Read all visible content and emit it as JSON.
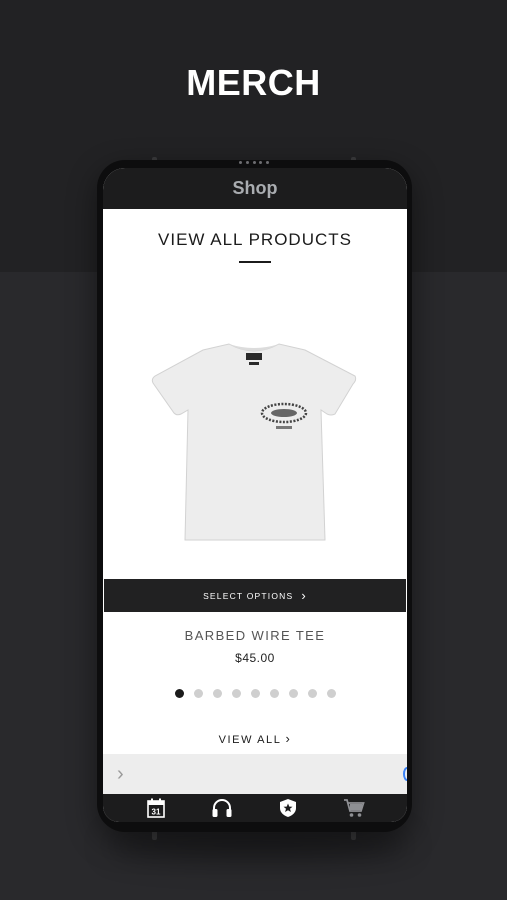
{
  "headline": "MERCH",
  "app": {
    "title": "Shop"
  },
  "section": {
    "title": "VIEW ALL PRODUCTS"
  },
  "product": {
    "image_icon": "tshirt-image",
    "select_label": "SELECT OPTIONS",
    "name": "BARBED WIRE TEE",
    "price": "$45.00"
  },
  "carousel": {
    "total": 9,
    "active_index": 0
  },
  "view_all_label": "VIEW ALL",
  "tabs": [
    {
      "name": "calendar",
      "icon": "calendar-icon",
      "label": "31"
    },
    {
      "name": "music",
      "icon": "headphones-icon"
    },
    {
      "name": "badge",
      "icon": "shield-star-icon"
    },
    {
      "name": "shop",
      "icon": "cart-icon"
    }
  ],
  "colors": {
    "background": "#29292c",
    "appbar": "#1c1c1d",
    "button": "#212122",
    "active_dot": "#1b1b1b",
    "inactive_dot": "#cfcfcf"
  }
}
